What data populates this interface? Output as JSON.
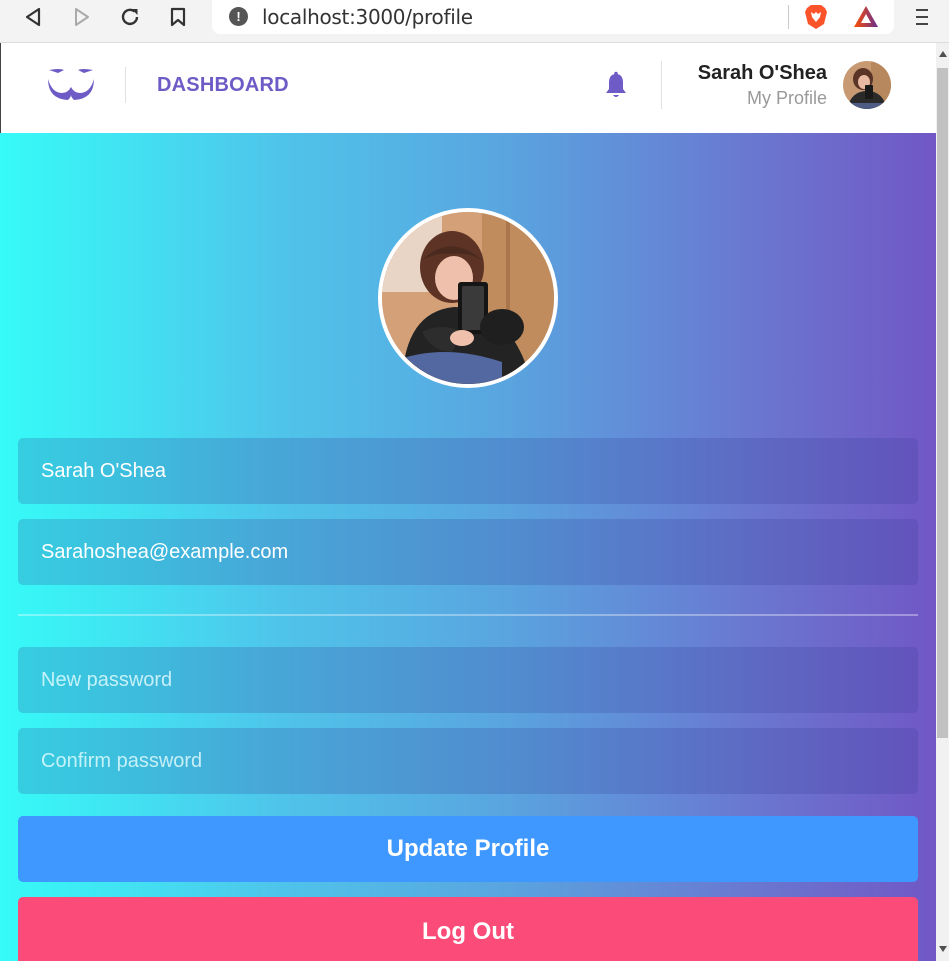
{
  "browser": {
    "url": "localhost:3000/profile",
    "icons": [
      "back-icon",
      "forward-icon",
      "reload-icon",
      "bookmark-icon",
      "site-info-icon",
      "brave-shield-icon",
      "brave-rewards-icon",
      "menu-icon"
    ]
  },
  "header": {
    "nav_label": "DASHBOARD",
    "user_name": "Sarah O'Shea",
    "user_sub": "My Profile",
    "accent": "#6e5bc6"
  },
  "form": {
    "name_value": "Sarah O'Shea",
    "email_value": "Sarahoshea@example.com",
    "new_password_placeholder": "New password",
    "confirm_password_placeholder": "Confirm password"
  },
  "buttons": {
    "update": "Update Profile",
    "logout": "Log Out",
    "update_color": "#3e98ff",
    "logout_color": "#fb4b78"
  },
  "gradient": {
    "from": "#36fbf8",
    "to": "#7157c5"
  }
}
